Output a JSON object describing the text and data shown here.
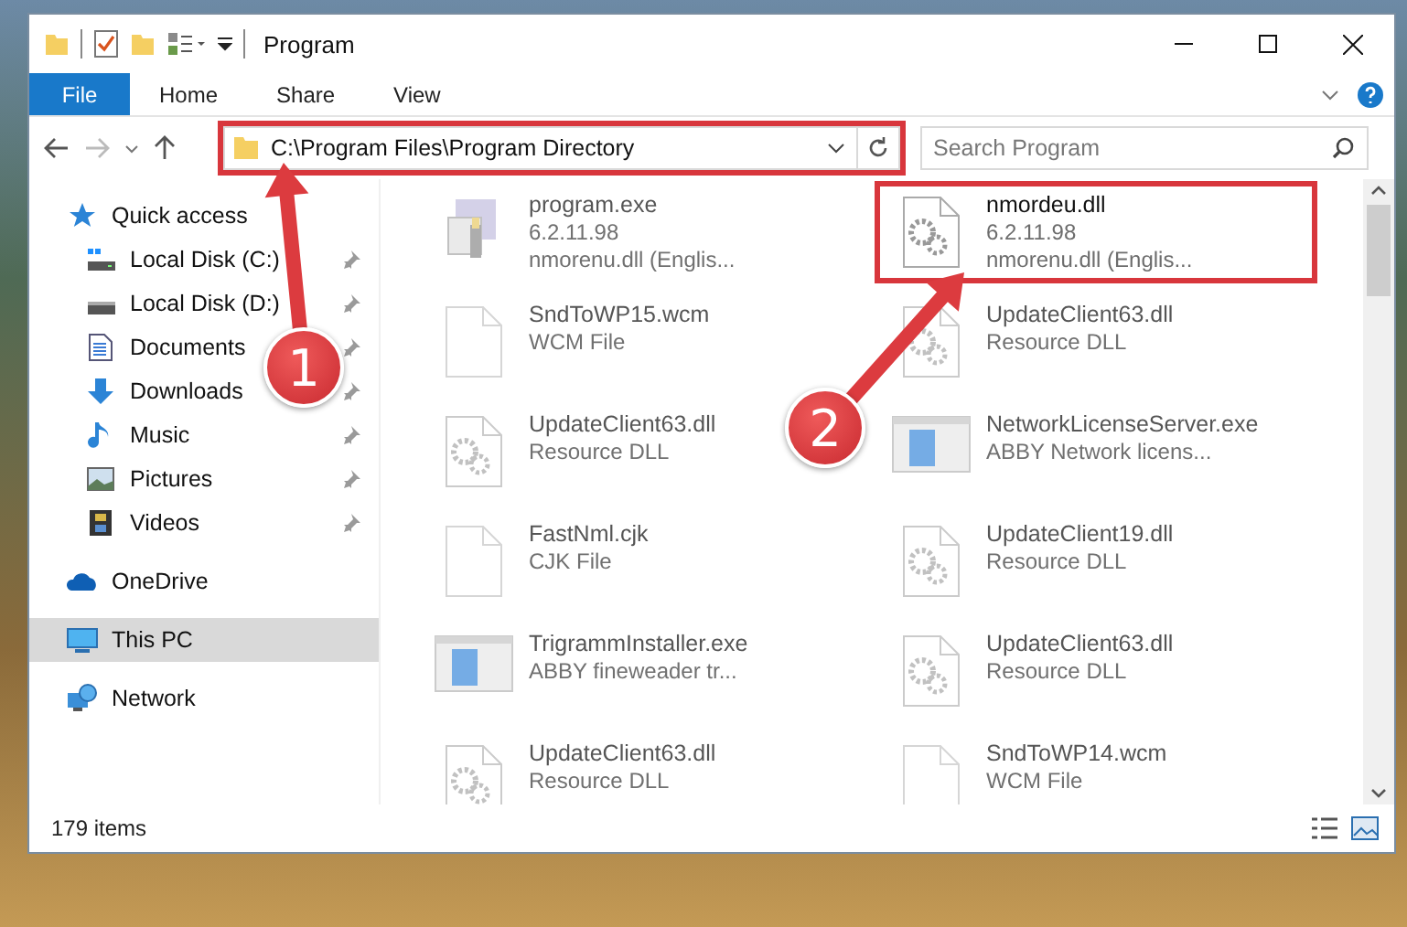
{
  "window": {
    "title": "Program"
  },
  "ribbon_tabs": [
    {
      "label": "File",
      "kind": "file"
    },
    {
      "label": "Home",
      "kind": "tab"
    },
    {
      "label": "Share",
      "kind": "tab"
    },
    {
      "label": "View",
      "kind": "tab"
    }
  ],
  "address_bar": {
    "path": "C:\\Program Files\\Program Directory",
    "highlighted": true
  },
  "search": {
    "placeholder": "Search Program"
  },
  "sidebar": {
    "items": [
      {
        "label": "Quick access",
        "kind": "star",
        "selected": false,
        "children": [
          {
            "label": "Local Disk (C:)",
            "kind": "drive-c",
            "pinned": true
          },
          {
            "label": "Local Disk (D:)",
            "kind": "drive",
            "pinned": true
          },
          {
            "label": "Documents",
            "kind": "documents",
            "pinned": true
          },
          {
            "label": "Downloads",
            "kind": "downloads",
            "pinned": true
          },
          {
            "label": "Music",
            "kind": "music",
            "pinned": true
          },
          {
            "label": "Pictures",
            "kind": "pictures",
            "pinned": true
          },
          {
            "label": "Videos",
            "kind": "videos",
            "pinned": true
          }
        ]
      },
      {
        "label": "OneDrive",
        "kind": "cloud",
        "selected": false
      },
      {
        "label": "This PC",
        "kind": "pc",
        "selected": true
      },
      {
        "label": "Network",
        "kind": "network",
        "selected": false
      }
    ]
  },
  "files": [
    {
      "name": "program.exe",
      "details": [
        "6.2.11.98",
        "nmorenu.dll (Englis..."
      ],
      "kind": "app",
      "blurred": true,
      "highlighted": false
    },
    {
      "name": "nmordeu.dll",
      "details": [
        "6.2.11.98",
        "nmorenu.dll (Englis..."
      ],
      "kind": "dll",
      "blurred": false,
      "highlighted": true
    },
    {
      "name": "SndToWP15.wcm",
      "details": [
        "WCM File"
      ],
      "kind": "blank",
      "blurred": true,
      "highlighted": false
    },
    {
      "name": "UpdateClient63.dll",
      "details": [
        "Resource DLL"
      ],
      "kind": "dll",
      "blurred": true,
      "highlighted": false
    },
    {
      "name": "UpdateClient63.dll",
      "details": [
        "Resource DLL"
      ],
      "kind": "dll",
      "blurred": true,
      "highlighted": false
    },
    {
      "name": "NetworkLicenseServer.exe",
      "details": [
        "ABBY Network licens..."
      ],
      "kind": "window",
      "blurred": true,
      "highlighted": false
    },
    {
      "name": "FastNml.cjk",
      "details": [
        "CJK File"
      ],
      "kind": "blank",
      "blurred": true,
      "highlighted": false
    },
    {
      "name": "UpdateClient19.dll",
      "details": [
        "Resource DLL"
      ],
      "kind": "dll",
      "blurred": true,
      "highlighted": false
    },
    {
      "name": "TrigrammInstaller.exe",
      "details": [
        "ABBY fineweader tr..."
      ],
      "kind": "window",
      "blurred": true,
      "highlighted": false
    },
    {
      "name": "UpdateClient63.dll",
      "details": [
        "Resource DLL"
      ],
      "kind": "dll",
      "blurred": true,
      "highlighted": false
    },
    {
      "name": "UpdateClient63.dll",
      "details": [
        "Resource DLL"
      ],
      "kind": "dll",
      "blurred": true,
      "highlighted": false
    },
    {
      "name": "SndToWP14.wcm",
      "details": [
        "WCM File"
      ],
      "kind": "blank",
      "blurred": true,
      "highlighted": false
    }
  ],
  "status_bar": {
    "item_count": "179 items"
  },
  "annotations": [
    {
      "label": "1"
    },
    {
      "label": "2"
    }
  ]
}
